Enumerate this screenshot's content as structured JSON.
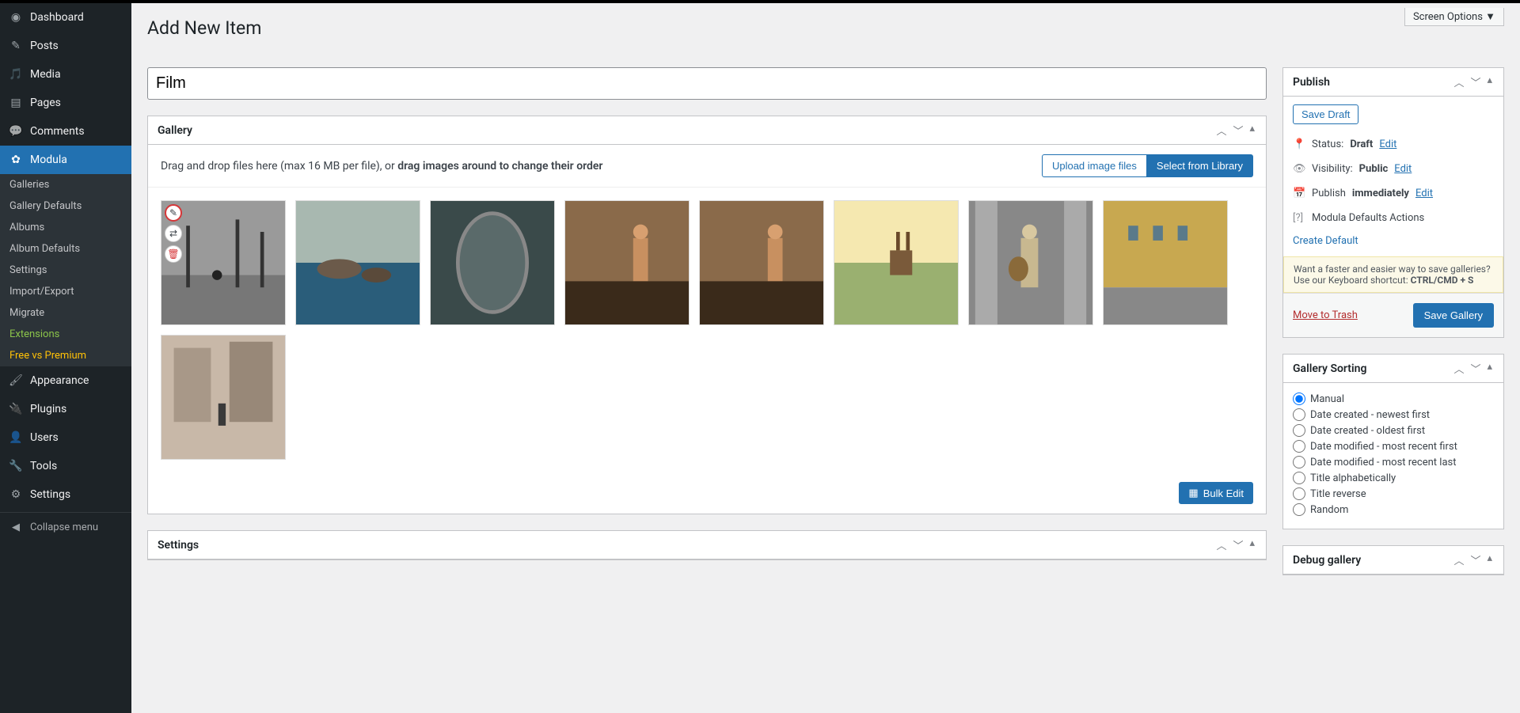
{
  "screen_options_label": "Screen Options  ▼",
  "page_title": "Add New Item",
  "title_value": "Film",
  "sidebar": {
    "items": [
      {
        "label": "Dashboard",
        "name": "dashboard"
      },
      {
        "label": "Posts",
        "name": "posts"
      },
      {
        "label": "Media",
        "name": "media"
      },
      {
        "label": "Pages",
        "name": "pages"
      },
      {
        "label": "Comments",
        "name": "comments"
      },
      {
        "label": "Modula",
        "name": "modula",
        "active": true
      },
      {
        "label": "Appearance",
        "name": "appearance"
      },
      {
        "label": "Plugins",
        "name": "plugins"
      },
      {
        "label": "Users",
        "name": "users"
      },
      {
        "label": "Tools",
        "name": "tools"
      },
      {
        "label": "Settings",
        "name": "settings"
      }
    ],
    "submenu": [
      {
        "label": "Galleries"
      },
      {
        "label": "Gallery Defaults"
      },
      {
        "label": "Albums"
      },
      {
        "label": "Album Defaults"
      },
      {
        "label": "Settings"
      },
      {
        "label": "Import/Export"
      },
      {
        "label": "Migrate"
      },
      {
        "label": "Extensions",
        "class": "highlight-green"
      },
      {
        "label": "Free vs Premium",
        "class": "highlight-yellow"
      }
    ],
    "collapse_label": "Collapse menu"
  },
  "gallery": {
    "panel_title": "Gallery",
    "drag_prefix": "Drag and drop files here (max 16 MB per file), or ",
    "drag_bold": "drag images around to change their order",
    "upload_btn": "Upload image files",
    "select_btn": "Select from Library",
    "bulk_edit": "Bulk Edit",
    "thumb_count": 9
  },
  "settings_panel_title": "Settings",
  "publish": {
    "panel_title": "Publish",
    "save_draft": "Save Draft",
    "status_label": "Status:",
    "status_value": "Draft",
    "visibility_label": "Visibility:",
    "visibility_value": "Public",
    "publish_label": "Publish",
    "publish_value": "immediately",
    "edit": "Edit",
    "defaults_label": "Modula Defaults Actions",
    "create_default": "Create Default",
    "hint_prefix": "Want a faster and easier way to save galleries? Use our Keyboard shortcut: ",
    "hint_bold": "CTRL/CMD + S",
    "trash": "Move to Trash",
    "save_gallery": "Save Gallery"
  },
  "sorting": {
    "panel_title": "Gallery Sorting",
    "options": [
      "Manual",
      "Date created - newest first",
      "Date created - oldest first",
      "Date modified - most recent first",
      "Date modified - most recent last",
      "Title alphabetically",
      "Title reverse",
      "Random"
    ],
    "selected_index": 0
  },
  "debug_panel_title": "Debug gallery"
}
